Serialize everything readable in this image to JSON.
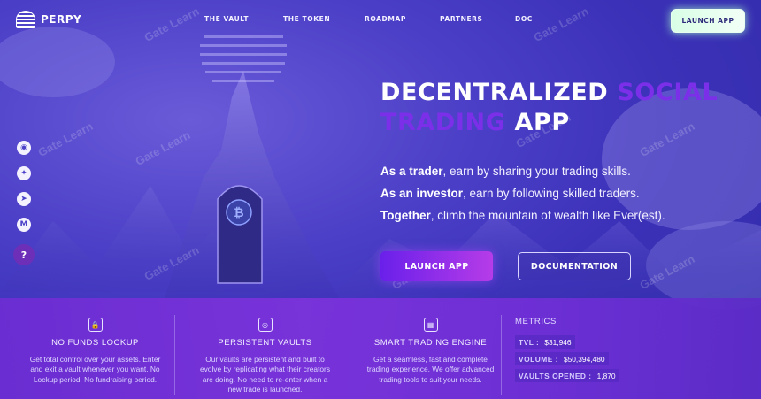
{
  "header": {
    "logo_text": "PERPY",
    "nav": [
      "THE VAULT",
      "THE TOKEN",
      "ROADMAP",
      "PARTNERS",
      "DOC"
    ],
    "launch_label": "LAUNCH APP"
  },
  "social": {
    "icons": [
      "discord-icon",
      "twitter-icon",
      "telegram-icon",
      "medium-icon"
    ],
    "help_label": "?"
  },
  "hero": {
    "title_part1": "DECENTRALIZED ",
    "title_accent1": "SOCIAL",
    "title_accent2": "TRADING",
    "title_part2": " APP",
    "lines": [
      {
        "strong": "As a trader",
        "rest": ", earn by sharing your trading skills."
      },
      {
        "strong": "As an investor",
        "rest": ", earn by following skilled traders."
      },
      {
        "strong": "Together",
        "rest": ", climb the mountain of wealth like Ever(est)."
      }
    ],
    "launch_label": "LAUNCH APP",
    "docs_label": "DOCUMENTATION"
  },
  "features": [
    {
      "title": "NO FUNDS LOCKUP",
      "desc": "Get total control over your assets. Enter and exit a vault whenever you want. No Lockup period. No fundraising period."
    },
    {
      "title": "PERSISTENT VAULTS",
      "desc": "Our vaults are persistent and built to evolve by replicating what their creators are doing. No need to re-enter when a new trade is launched."
    },
    {
      "title": "SMART TRADING ENGINE",
      "desc": "Get a seamless, fast and complete trading experience. We offer advanced trading tools to suit your needs."
    }
  ],
  "metrics": {
    "title": "METRICS",
    "items": [
      {
        "label": "TVL :",
        "value": "$31,946"
      },
      {
        "label": "VOLUME :",
        "value": "$50,394,480"
      },
      {
        "label": "VAULTS OPENED :",
        "value": "1,870"
      }
    ]
  },
  "watermark": "Gate Learn"
}
